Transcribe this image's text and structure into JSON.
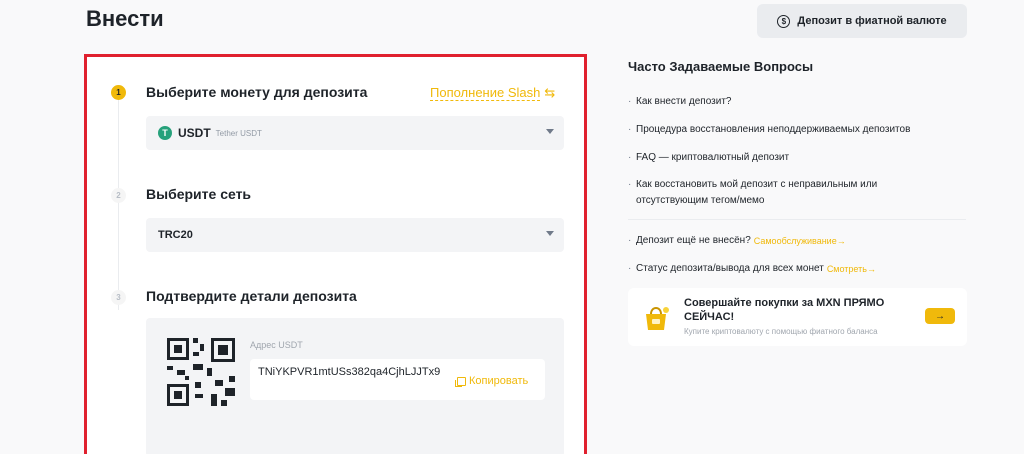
{
  "header": {
    "title": "Внести",
    "fiat_button_label": "Депозит в фиатной валюте",
    "fiat_icon_glyph": "$"
  },
  "deposit": {
    "steps": [
      {
        "number": "1",
        "title": "Выберите монету для депозита"
      },
      {
        "number": "2",
        "title": "Выберите сеть"
      },
      {
        "number": "3",
        "title": "Подтвердите детали депозита"
      }
    ],
    "slash_link": "Пополнение Slash",
    "coin": {
      "icon_glyph": "T",
      "symbol": "USDT",
      "name": "Tether USDT",
      "icon_color": "#26a17b"
    },
    "network": "TRC20",
    "address_label": "Адрес USDT",
    "address": "TNiYKPVR1mtUSs382qa4CjhLJJTx9",
    "copy_label": "Копировать"
  },
  "faq": {
    "title": "Часто Задаваемые Вопросы",
    "items": [
      "Как внести депозит?",
      "Процедура восстановления неподдерживаемых депозитов",
      "FAQ — криптовалютный депозит",
      "Как восстановить мой депозит с неправильным или",
      "отсутствующим тегом/мемо"
    ],
    "extra": [
      {
        "text": "Депозит ещё не внесён?",
        "link": "Самообслуживание→"
      },
      {
        "text": "Статус депозита/вывода для всех монет",
        "link": "Смотреть→"
      }
    ]
  },
  "promo": {
    "title": "Совершайте покупки за MXN ПРЯМО СЕЙЧАС!",
    "subtitle": "Купите криптовалюту с помощью фиатного баланса",
    "button_glyph": "→"
  },
  "colors": {
    "accent": "#f0b90b",
    "highlight_border": "#e0202e",
    "text": "#1e2329"
  }
}
